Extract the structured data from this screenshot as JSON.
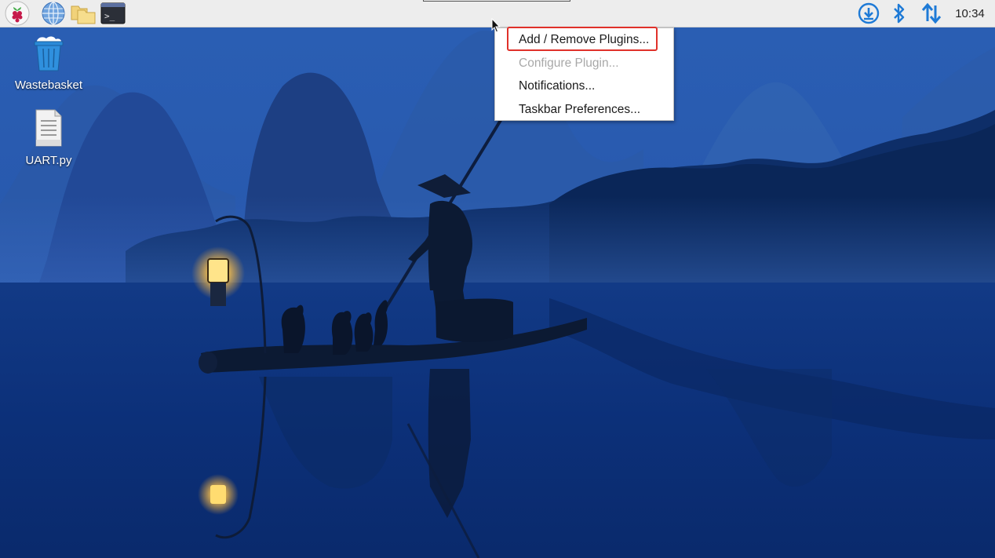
{
  "taskbar": {
    "launchers": [
      {
        "name": "raspberry-menu",
        "icon": "raspberry-icon"
      },
      {
        "name": "web-browser",
        "icon": "globe-icon"
      },
      {
        "name": "file-manager",
        "icon": "folders-icon"
      },
      {
        "name": "terminal",
        "icon": "terminal-icon",
        "glyph": ">_"
      }
    ],
    "tray": [
      {
        "name": "updates",
        "icon": "download-circle-icon"
      },
      {
        "name": "bluetooth",
        "icon": "bluetooth-icon"
      },
      {
        "name": "network",
        "icon": "network-arrows-icon"
      }
    ],
    "clock": "10:34"
  },
  "desktop": {
    "icons": [
      {
        "label": "Wastebasket",
        "icon": "trash-bin-icon"
      },
      {
        "label": "UART.py",
        "icon": "text-file-icon"
      }
    ]
  },
  "context_menu": {
    "items": [
      {
        "label": "Add / Remove Plugins...",
        "enabled": true,
        "highlighted": true
      },
      {
        "label": "Configure Plugin...",
        "enabled": false
      },
      {
        "label": "Notifications...",
        "enabled": true
      },
      {
        "label": "Taskbar Preferences...",
        "enabled": true
      }
    ]
  },
  "colors": {
    "accent_blue": "#1e7ad6",
    "highlight_red": "#e0312a",
    "taskbar_bg": "#ededed",
    "sky_blue": "#2f63b8",
    "water_dark": "#0a2a6a"
  }
}
